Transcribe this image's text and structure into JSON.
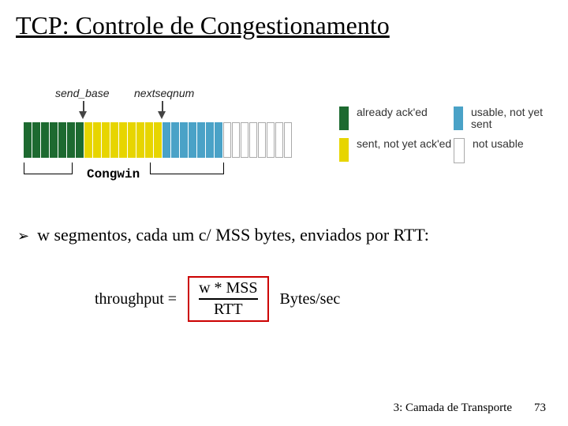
{
  "title": "TCP: Controle de Congestionamento",
  "diagram": {
    "label_send_base": "send_base",
    "label_nextseqnum": "nextseqnum",
    "congwin_label": "Congwin",
    "legend": {
      "acked": "already ack'ed",
      "sent": "sent, not yet ack'ed",
      "usable": "usable, not yet sent",
      "not_usable": "not usable"
    }
  },
  "bullet": "w segmentos, cada um c/ MSS bytes, enviados por RTT:",
  "formula": {
    "lhs": "throughput =",
    "numerator": "w * MSS",
    "denominator": "RTT",
    "units": "Bytes/sec"
  },
  "footer": {
    "chapter": "3: Camada de Transporte",
    "page": "73"
  }
}
